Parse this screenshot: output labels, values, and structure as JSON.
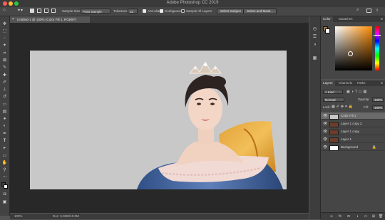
{
  "window": {
    "title": "Adobe Photoshop CC 2019"
  },
  "options_bar": {
    "sample_size_label": "Sample Size:",
    "sample_size_value": "Point Sample",
    "tolerance_label": "Tolerance:",
    "tolerance_value": "32",
    "anti_alias_label": "Anti-alias",
    "contiguous_label": "Contiguous",
    "sample_all_layers_label": "Sample All Layers",
    "select_subject_label": "Select Subject",
    "select_and_mask_label": "Select and Mask..."
  },
  "document": {
    "tab_title": "Untitled-1 @ 100% (Color Fill 1, RGB/8*)",
    "canvas_background_color": "#c8c8c8"
  },
  "status_bar": {
    "zoom": "100%",
    "doc_info": "Doc: 5.93M/10.0M"
  },
  "color_panel": {
    "tabs": [
      "Color",
      "Swatches"
    ],
    "foreground_color": "#9e7a54",
    "hue_accent": "#ff8c00"
  },
  "layers_panel": {
    "tabs": [
      "Layers",
      "Channels",
      "Paths"
    ],
    "filter_value": "Kind",
    "blend_mode": "Normal",
    "opacity_label": "Opacity:",
    "opacity_value": "100%",
    "lock_label": "Lock:",
    "fill_label": "Fill:",
    "fill_value": "100%",
    "layers": [
      {
        "name": "Color Fill 1",
        "selected": true,
        "thumb_color": "#c8c8c8"
      },
      {
        "name": "Layer 1 copy 2",
        "selected": false,
        "thumb_color": "#6b3d2a"
      },
      {
        "name": "Layer 1 copy",
        "selected": false,
        "thumb_color": "#6b3d2a"
      },
      {
        "name": "Layer 1",
        "selected": false,
        "thumb_color": "#6b3d2a"
      },
      {
        "name": "Background",
        "selected": false,
        "thumb_color": "#ffffff"
      }
    ]
  },
  "icons": {
    "move": "move-icon",
    "marquee": "marquee-icon",
    "lasso": "lasso-icon",
    "magic_wand": "magic-wand-icon",
    "crop": "crop-icon",
    "eyedropper": "eyedropper-icon",
    "healing": "healing-brush-icon",
    "brush": "brush-icon",
    "stamp": "clone-stamp-icon",
    "history": "history-brush-icon",
    "eraser": "eraser-icon",
    "gradient": "gradient-icon",
    "blur": "blur-icon",
    "dodge": "dodge-icon",
    "pen": "pen-icon",
    "type": "type-icon",
    "path": "path-selection-icon",
    "shape": "shape-icon",
    "hand": "hand-icon",
    "zoom": "zoom-icon"
  }
}
